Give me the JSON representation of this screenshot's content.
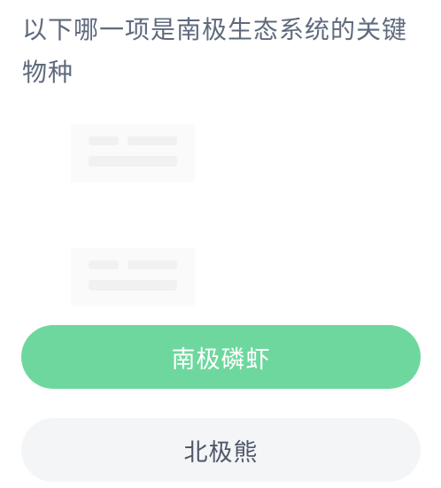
{
  "question": {
    "text": "以下哪一项是南极生态系统的关键物种"
  },
  "options": [
    {
      "label": "南极磷虾",
      "state": "selected",
      "color": "#6ed79e"
    },
    {
      "label": "北极熊",
      "state": "default",
      "color": "#f4f5f7"
    }
  ],
  "colors": {
    "question_text": "#5f6a7d",
    "selected_bg": "#6ed79e",
    "selected_text": "#ffffff",
    "default_bg": "#f4f5f7",
    "default_text": "#4f5869"
  }
}
